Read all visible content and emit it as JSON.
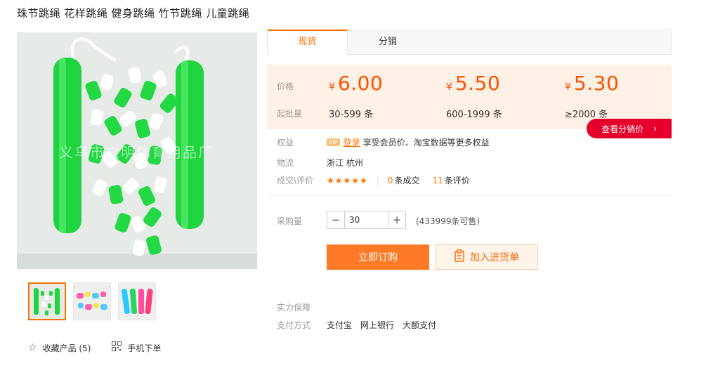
{
  "product": {
    "title": "珠节跳绳 花样跳绳 健身跳绳 竹节跳绳 儿童跳绳",
    "watermark": "义乌市立明体育用品厂"
  },
  "tabs": [
    {
      "label": "现货",
      "active": true
    },
    {
      "label": "分销",
      "active": false
    }
  ],
  "pricing": {
    "price_label": "价格",
    "moq_label": "起批量",
    "currency": "¥",
    "tiers": [
      {
        "price": "6.00",
        "range": "30-599 条"
      },
      {
        "price": "5.50",
        "range": "600-1999 条"
      },
      {
        "price": "5.30",
        "range": "≥2000 条"
      }
    ],
    "distribution_button": "查看分销价",
    "distribution_arrow": "›"
  },
  "benefits": {
    "label": "权益",
    "vip_badge": "VIP",
    "login_link": "登录",
    "text": "享受会员价、淘宝数据等更多权益"
  },
  "logistics": {
    "label": "物流",
    "value": "浙江 杭州"
  },
  "reviews": {
    "label": "成交\\评价",
    "stars": "★★★★★",
    "rating": 4.5,
    "deals_count": "0",
    "deals_text": "条成交",
    "review_count": "11",
    "review_text": "条评价"
  },
  "purchase": {
    "qty_label": "采购量",
    "minus": "−",
    "plus": "+",
    "qty_value": "30",
    "available": "(433999条可售)",
    "buy_button": "立即订购",
    "cart_button": "加入进货单"
  },
  "guarantee": {
    "label": "实力保障"
  },
  "payment": {
    "label": "支付方式",
    "methods": [
      "支付宝",
      "网上银行",
      "大额支付"
    ]
  },
  "links": {
    "favorite": "收藏产品 (5)",
    "mobile": "手机下单"
  },
  "colors": {
    "accent": "#ff7300",
    "price": "#ff5000",
    "distribution": "#e4002b",
    "rope_green": "#22dd44"
  },
  "icons": {
    "favorite": "star-outline-icon",
    "mobile": "qr-code-icon",
    "cart": "clipboard-icon"
  }
}
